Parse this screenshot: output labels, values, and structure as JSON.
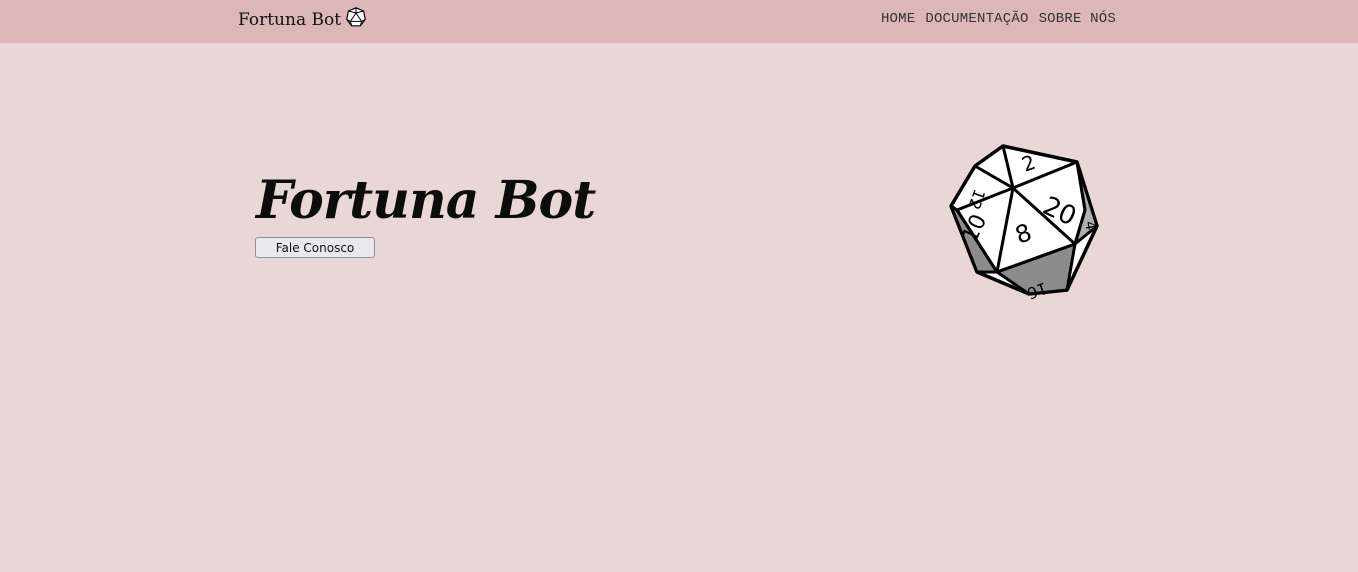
{
  "navbar": {
    "brand_label": "Fortuna Bot",
    "brand_icon": "d20-dice-icon",
    "links": [
      {
        "label": "HOME"
      },
      {
        "label": "DOCUMENTAÇÃO"
      },
      {
        "label": "SOBRE NÓS"
      }
    ]
  },
  "hero": {
    "title": "Fortuna Bot",
    "button_label": "Fale Conosco",
    "image_icon": "d20-dice-icon",
    "dice_faces": [
      "2",
      "20",
      "12",
      "10",
      "8",
      "16",
      "4"
    ]
  },
  "colors": {
    "background": "#e9d6d6",
    "navbar": "#dcb7b7"
  }
}
